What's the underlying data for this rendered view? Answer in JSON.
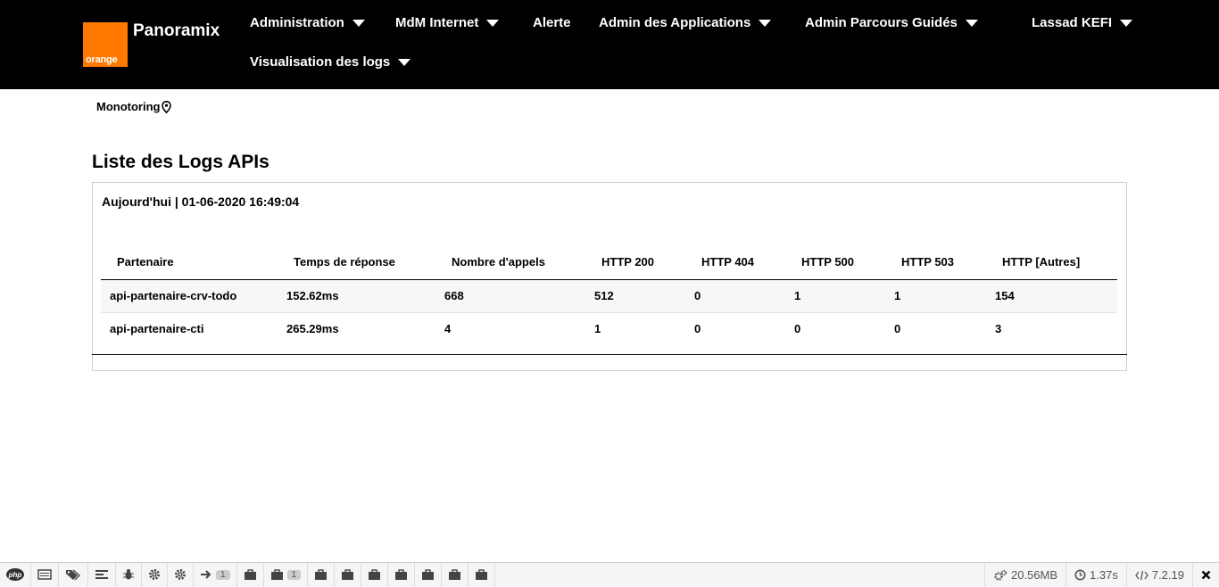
{
  "brand": {
    "logo_text": "orange",
    "name": "Panoramix",
    "logo_color": "#ff7900"
  },
  "nav": {
    "items": [
      {
        "label": "Administration"
      },
      {
        "label": "MdM Internet"
      },
      {
        "label": "Alerte"
      },
      {
        "label": "Admin des Applications"
      },
      {
        "label": "Admin Parcours Guidés"
      },
      {
        "label": "Visualisation des logs"
      }
    ],
    "user": "Lassad KEFI"
  },
  "breadcrumb": "Monotoring",
  "page_title": "Liste des Logs APIs",
  "panel": {
    "date_line": "Aujourd'hui | 01-06-2020 16:49:04",
    "columns": [
      "Partenaire",
      "Temps de réponse",
      "Nombre d'appels",
      "HTTP 200",
      "HTTP 404",
      "HTTP 500",
      "HTTP 503",
      "HTTP [Autres]"
    ],
    "rows": [
      [
        "api-partenaire-crv-todo",
        "152.62ms",
        "668",
        "512",
        "0",
        "1",
        "1",
        "154"
      ],
      [
        "api-partenaire-cti",
        "265.29ms",
        "4",
        "1",
        "0",
        "0",
        "0",
        "3"
      ]
    ]
  },
  "debugbar": {
    "php_label": "php",
    "badge_1": "1",
    "badge_2": "1",
    "memory": "20.56MB",
    "time": "1.37s",
    "version": "7.2.19"
  }
}
